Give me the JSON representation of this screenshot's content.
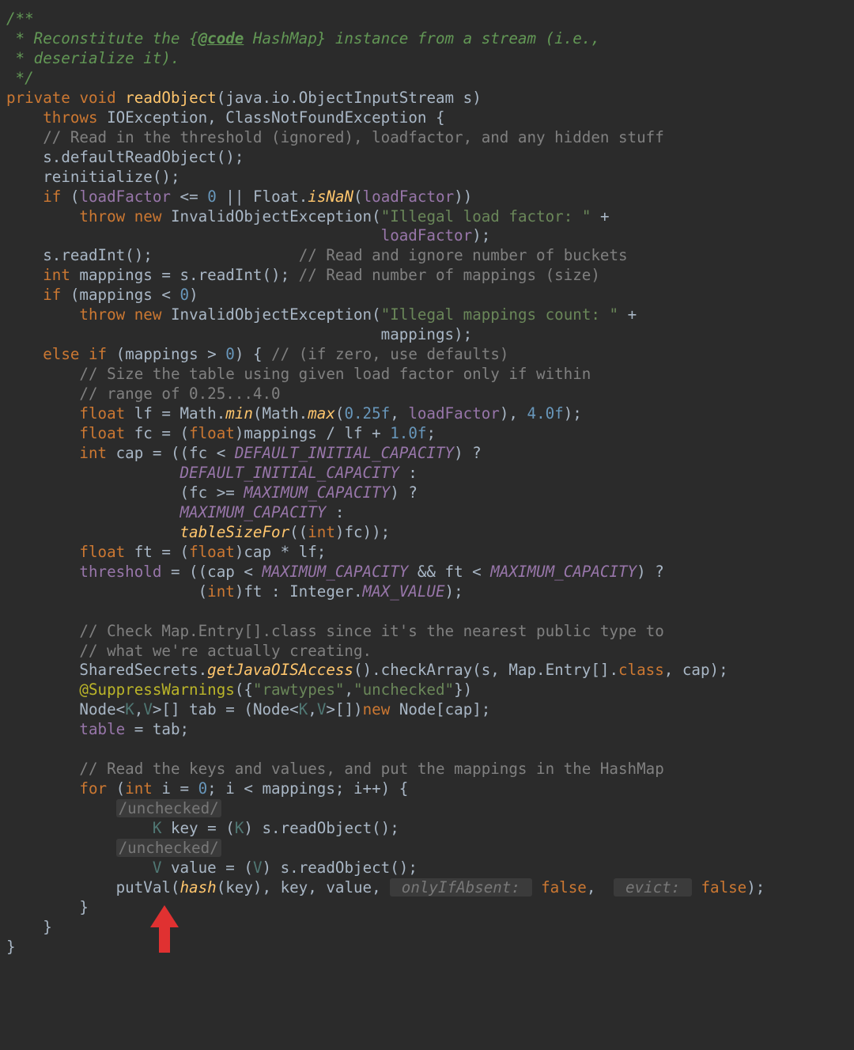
{
  "javadoc": {
    "open": "/**",
    "l1a": " * Reconstitute the {",
    "tag": "@code",
    "l1b": " HashMap} instance from a stream (i.e.,",
    "l2": " * deserialize it).",
    "close": " */"
  },
  "sig": {
    "private": "private",
    "void": "void",
    "name": "readObject",
    "lp": "(",
    "ptype": "java.io.ObjectInputStream s",
    "rp": ")"
  },
  "throws": {
    "kw": "throws",
    "ex1": "IOException",
    "comma": ", ",
    "ex2": "ClassNotFoundException",
    "brace": " {"
  },
  "c1": "// Read in the threshold (ignored), loadfactor, and any hidden stuff",
  "l_dro": {
    "a": "s.",
    "b": "defaultReadObject",
    "c": "();"
  },
  "l_reinit": {
    "a": "reinitialize",
    "b": "();"
  },
  "if1": {
    "if": "if",
    "lp": " (",
    "lf1": "loadFactor",
    "op1": " <= ",
    "zero": "0",
    "or": " || ",
    "fl": "Float.",
    "isnan": "isNaN",
    "lp2": "(",
    "lf2": "loadFactor",
    "rp": "))"
  },
  "thr1": {
    "throw": "throw",
    "new": "new",
    "ex": "InvalidObjectException",
    "lp": "(",
    "str": "\"Illegal load factor: \"",
    "plus": " +",
    "lf": "loadFactor",
    "rp": ");"
  },
  "l_ri": {
    "a": "s.readInt();",
    "c": "// Read and ignore number of buckets"
  },
  "l_map": {
    "int": "int",
    "var": " mappings = s.readInt(); ",
    "c": "// Read number of mappings (size)"
  },
  "if2": {
    "if": "if",
    "lp": " (mappings < ",
    "zero": "0",
    "rp": ")"
  },
  "thr2": {
    "throw": "throw",
    "new": "new",
    "ex": "InvalidObjectException",
    "lp": "(",
    "str": "\"Illegal mappings count: \"",
    "plus": " +",
    "arg": "mappings);"
  },
  "elif": {
    "else": "else",
    "if": "if",
    "lp": " (mappings > ",
    "zero": "0",
    "rp": ") { ",
    "c": "// (if zero, use defaults)"
  },
  "c2a": "// Size the table using given load factor only if within",
  "c2b": "// range of 0.25...4.0",
  "l_lf": {
    "float": "float",
    "a": " lf = Math.",
    "min": "min",
    "b": "(Math.",
    "max": "max",
    "c": "(",
    "n1": "0.25f",
    "d": ", ",
    "lf": "loadFactor",
    "e": "), ",
    "n2": "4.0f",
    "f": ");"
  },
  "l_fc": {
    "float": "float",
    "a": " fc = (",
    "cast": "float",
    "b": ")mappings / lf + ",
    "one": "1.0f",
    "c": ";"
  },
  "l_cap1": {
    "int": "int",
    "a": " cap = ((fc < ",
    "dic": "DEFAULT_INITIAL_CAPACITY",
    "b": ") ?"
  },
  "l_cap2": {
    "dic": "DEFAULT_INITIAL_CAPACITY",
    "a": " :"
  },
  "l_cap3": {
    "a": "(fc >= ",
    "mc": "MAXIMUM_CAPACITY",
    "b": ") ?"
  },
  "l_cap4": {
    "mc": "MAXIMUM_CAPACITY",
    "a": " :"
  },
  "l_cap5": {
    "fn": "tableSizeFor",
    "a": "((",
    "cast": "int",
    "b": ")fc));"
  },
  "l_ft": {
    "float": "float",
    "a": " ft = (",
    "cast": "float",
    "b": ")cap * lf;"
  },
  "l_thr": {
    "fld": "threshold",
    "a": " = ((cap < ",
    "mc1": "MAXIMUM_CAPACITY",
    "b": " && ft < ",
    "mc2": "MAXIMUM_CAPACITY",
    "c": ") ?"
  },
  "l_thr2": {
    "a": "(",
    "cast": "int",
    "b": ")ft : Integer.",
    "mv": "MAX_VALUE",
    "c": ");"
  },
  "c3a": "// Check Map.Entry[].class since it's the nearest public type to",
  "c3b": "// what we're actually creating.",
  "l_ss": {
    "a": "SharedSecrets.",
    "m": "getJavaOISAccess",
    "b": "().checkArray(s, Map.Entry[].",
    "cls": "class",
    "c": ", cap);"
  },
  "l_sw": {
    "ann": "@SuppressWarnings",
    "a": "({",
    "s1": "\"rawtypes\"",
    "b": ",",
    "s2": "\"unchecked\"",
    "c": "})"
  },
  "l_node": {
    "a": "Node<",
    "k1": "K",
    "c1": ",",
    "v1": "V",
    "b": ">[] tab = (Node<",
    "k2": "K",
    "c2": ",",
    "v2": "V",
    "c": ">[])",
    "new": "new",
    "d": " Node[cap];"
  },
  "l_tab": {
    "fld": "table",
    "a": " = tab;"
  },
  "c4": "// Read the keys and values, and put the mappings in the HashMap",
  "for": {
    "for": "for",
    "a": " (",
    "int": "int",
    "b": " i = ",
    "zero": "0",
    "c": "; i < mappings; i++) {"
  },
  "hint_unchecked": "/unchecked/",
  "l_key": {
    "k": "K",
    "a": " key = (",
    "k2": "K",
    "b": ") s.readObject();"
  },
  "l_val": {
    "v": "V",
    "a": " value = (",
    "v2": "V",
    "b": ") s.readObject();"
  },
  "l_put": {
    "a": "putVal(",
    "hash": "hash",
    "b": "(key), key, value, ",
    "h1": " onlyIfAbsent: ",
    "f1": "false",
    "c": ",  ",
    "h2": " evict: ",
    "f2": "false",
    "d": ");"
  },
  "braces": {
    "rb": "}"
  }
}
